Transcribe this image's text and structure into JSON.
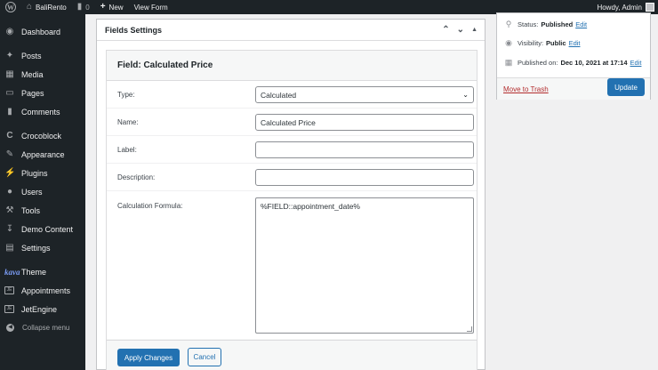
{
  "adminbar": {
    "site_name": "BaliRento",
    "comments_count": "0",
    "new_label": "New",
    "view_form_label": "View Form",
    "greeting": "Howdy, Admin"
  },
  "sidebar": {
    "items": [
      {
        "label": "Dashboard",
        "icon": "dashboard-icon"
      },
      {
        "label": "Posts",
        "icon": "pin-icon"
      },
      {
        "label": "Media",
        "icon": "media-icon"
      },
      {
        "label": "Pages",
        "icon": "pages-icon"
      },
      {
        "label": "Comments",
        "icon": "comment-icon"
      },
      {
        "label": "Crocoblock",
        "icon": "crocoblock-icon"
      },
      {
        "label": "Appearance",
        "icon": "brush-icon"
      },
      {
        "label": "Plugins",
        "icon": "plugin-icon"
      },
      {
        "label": "Users",
        "icon": "user-icon"
      },
      {
        "label": "Tools",
        "icon": "wrench-icon"
      },
      {
        "label": "Demo Content",
        "icon": "download-icon"
      },
      {
        "label": "Settings",
        "icon": "settings-icon"
      },
      {
        "label": "Theme",
        "icon": "kava-logo",
        "prefix": "kava"
      },
      {
        "label": "Appointments",
        "icon": "jet-box-icon"
      },
      {
        "label": "JetEngine",
        "icon": "jet-box-icon"
      }
    ],
    "collapse_label": "Collapse menu"
  },
  "panel": {
    "title": "Fields Settings",
    "field_title": "Field: Calculated Price",
    "rows": {
      "type_label": "Type:",
      "type_value": "Calculated",
      "name_label": "Name:",
      "name_value": "Calculated Price",
      "label_label": "Label:",
      "label_value": "",
      "description_label": "Description:",
      "description_value": "",
      "formula_label": "Calculation Formula:",
      "formula_value": "%FIELD::appointment_date%"
    },
    "apply_label": "Apply Changes",
    "cancel_label": "Cancel"
  },
  "publish": {
    "status_label": "Status:",
    "status_value": "Published",
    "visibility_label": "Visibility:",
    "visibility_value": "Public",
    "published_label": "Published on:",
    "published_value": "Dec 10, 2021 at 17:14",
    "edit_label": "Edit",
    "trash_label": "Move to Trash",
    "update_label": "Update"
  },
  "colors": {
    "admin_dark": "#1d2327",
    "primary_blue": "#2271b1",
    "trash_red": "#b32d2e"
  }
}
